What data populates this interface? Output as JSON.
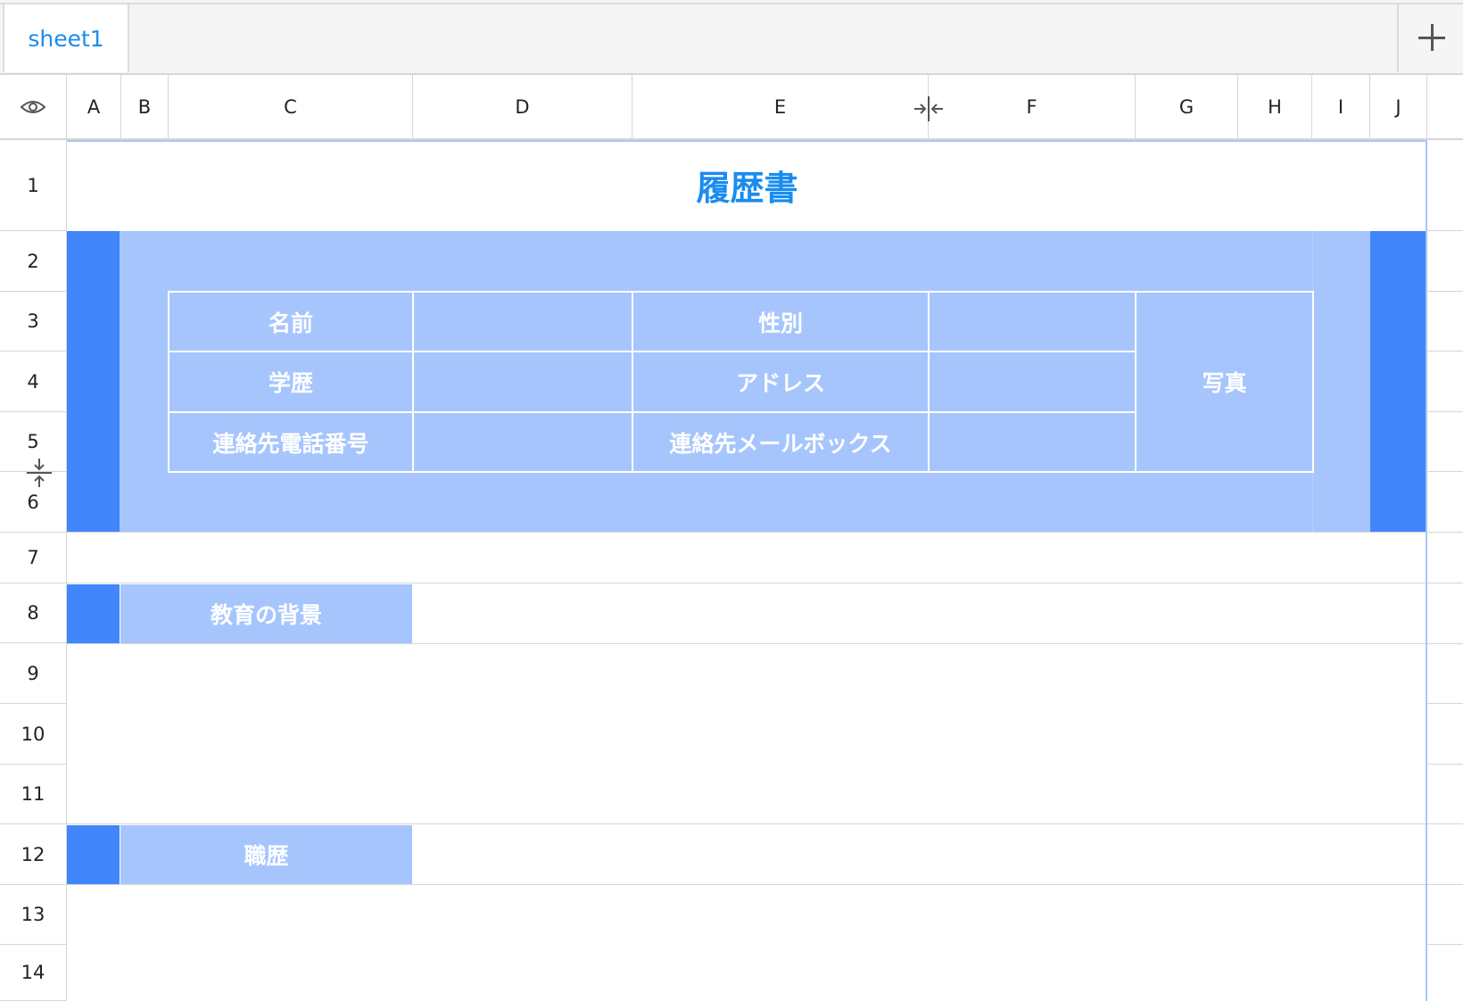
{
  "tabbar": {
    "sheet_tab": "sheet1",
    "add_sheet": "+"
  },
  "columns": [
    "A",
    "B",
    "C",
    "D",
    "E",
    "F",
    "G",
    "H",
    "I",
    "J"
  ],
  "rows": [
    "1",
    "2",
    "3",
    "4",
    "5",
    "6",
    "7",
    "8",
    "9",
    "10",
    "11",
    "12",
    "13",
    "14"
  ],
  "sheet": {
    "title": "履歴書",
    "info_table": {
      "name_label": "名前",
      "gender_label": "性別",
      "education_label": "学歴",
      "address_label": "アドレス",
      "phone_label": "連絡先電話番号",
      "email_label": "連絡先メールボックス",
      "photo_label": "写真"
    },
    "section_education": "教育の背景",
    "section_career": "職歴"
  },
  "colors": {
    "accent_text": "#1a8cf0",
    "light_block": "#a7c5fd",
    "dark_block": "#4286fc"
  },
  "icons": {
    "visibility": "eye-icon",
    "column_resize": "column-resize-icon",
    "row_resize": "row-resize-icon"
  }
}
